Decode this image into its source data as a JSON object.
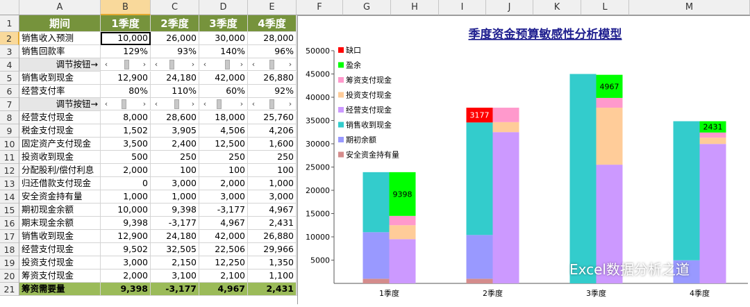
{
  "columns": [
    "A",
    "B",
    "C",
    "D",
    "E",
    "F",
    "G",
    "H",
    "I",
    "J",
    "K",
    "L",
    "M"
  ],
  "selected_column": "B",
  "selected_row": 2,
  "header_row": [
    "期间",
    "1季度",
    "2季度",
    "3季度",
    "4季度"
  ],
  "rows": [
    {
      "n": 2,
      "label": "销售收入预测",
      "vals": [
        "10,000",
        "26,000",
        "30,000",
        "28,000"
      ]
    },
    {
      "n": 3,
      "label": "销售回款率",
      "vals": [
        "129%",
        "93%",
        "140%",
        "96%"
      ]
    },
    {
      "n": 4,
      "label": "调节按钮→",
      "scroll": true,
      "thumbs": [
        0.55,
        0.35,
        0.7,
        0.5
      ]
    },
    {
      "n": 5,
      "label": "销售收到现金",
      "vals": [
        "12,900",
        "24,180",
        "42,000",
        "26,880"
      ]
    },
    {
      "n": 6,
      "label": "经营支付率",
      "vals": [
        "80%",
        "110%",
        "60%",
        "92%"
      ]
    },
    {
      "n": 7,
      "label": "调节按钮→",
      "scroll": true,
      "thumbs": [
        0.45,
        0.6,
        0.3,
        0.5
      ]
    },
    {
      "n": 8,
      "label": "经营支付现金",
      "vals": [
        "8,000",
        "28,600",
        "18,000",
        "25,760"
      ]
    },
    {
      "n": 9,
      "label": "税金支付现金",
      "vals": [
        "1,502",
        "3,905",
        "4,506",
        "4,206"
      ]
    },
    {
      "n": 10,
      "label": "固定资产支付现金",
      "vals": [
        "3,500",
        "2,400",
        "12,500",
        "1,600"
      ]
    },
    {
      "n": 11,
      "label": "投资收到现金",
      "vals": [
        "500",
        "250",
        "250",
        "250"
      ]
    },
    {
      "n": 12,
      "label": "分配股利/偿付利息",
      "vals": [
        "2,000",
        "100",
        "100",
        "100"
      ]
    },
    {
      "n": 13,
      "label": "归还借款支付现金",
      "vals": [
        "0",
        "3,000",
        "2,000",
        "1,000"
      ]
    },
    {
      "n": 14,
      "label": "安全资金持有量",
      "vals": [
        "1,000",
        "1,000",
        "3,000",
        "3,000"
      ]
    },
    {
      "n": 15,
      "label": "期初现金余额",
      "vals": [
        "10,000",
        "9,398",
        "-3,177",
        "4,967"
      ]
    },
    {
      "n": 16,
      "label": "期末现金余额",
      "vals": [
        "9,398",
        "-3,177",
        "4,967",
        "2,431"
      ]
    },
    {
      "n": 17,
      "label": "销售收到现金",
      "vals": [
        "12,900",
        "24,180",
        "42,000",
        "26,880"
      ]
    },
    {
      "n": 18,
      "label": "经营支付现金",
      "vals": [
        "9,502",
        "32,505",
        "22,506",
        "29,966"
      ]
    },
    {
      "n": 19,
      "label": "投资支付现金",
      "vals": [
        "3,000",
        "2,150",
        "12,250",
        "1,350"
      ]
    },
    {
      "n": 20,
      "label": "筹资支付现金",
      "vals": [
        "2,000",
        "3,100",
        "2,100",
        "1,100"
      ]
    },
    {
      "n": 21,
      "label": "筹资需要量",
      "vals": [
        "9,398",
        "-3,177",
        "4,967",
        "2,431"
      ],
      "total": true
    }
  ],
  "chart_data": {
    "type": "bar",
    "title": "季度资金预算敏感性分析模型",
    "categories": [
      "1季度",
      "2季度",
      "3季度",
      "4季度"
    ],
    "ylim": [
      0,
      50000
    ],
    "yticks": [
      "5000",
      "10000",
      "15000",
      "20000",
      "25000",
      "30000",
      "35000",
      "40000",
      "45000",
      "50000"
    ],
    "legend_position": "top-left",
    "stacks": [
      {
        "name": "left",
        "series": [
          {
            "name": "安全资金持有量",
            "color": "#d48c8c",
            "values": [
              1000,
              1000,
              0,
              0
            ]
          },
          {
            "name": "期初余额",
            "color": "#9999ff",
            "values": [
              10000,
              9398,
              0,
              4967
            ]
          },
          {
            "name": "销售收到现金",
            "color": "#33cccc",
            "values": [
              12900,
              24180,
              45000,
              29880
            ]
          },
          {
            "name": "缺口",
            "color": "#ff0000",
            "values": [
              0,
              3177,
              0,
              0
            ]
          }
        ]
      },
      {
        "name": "right",
        "series": [
          {
            "name": "经营支付现金",
            "color": "#cc99ff",
            "values": [
              9502,
              32505,
              25506,
              29966
            ]
          },
          {
            "name": "投资支付现金",
            "color": "#ffcc99",
            "values": [
              3000,
              2150,
              12250,
              1350
            ]
          },
          {
            "name": "筹资支付现金",
            "color": "#ff99cc",
            "values": [
              2000,
              3100,
              2100,
              1100
            ]
          },
          {
            "name": "盈余",
            "color": "#00ff00",
            "values": [
              9398,
              0,
              4967,
              2431
            ]
          }
        ]
      }
    ],
    "data_labels": [
      {
        "category": "1季度",
        "stack": "right",
        "series": "盈余",
        "text": "9398"
      },
      {
        "category": "2季度",
        "stack": "left",
        "series": "缺口",
        "text": "3177"
      },
      {
        "category": "3季度",
        "stack": "right",
        "series": "盈余",
        "text": "4967"
      },
      {
        "category": "4季度",
        "stack": "right",
        "series": "盈余",
        "text": "2431"
      }
    ],
    "legend": [
      {
        "name": "缺口",
        "color": "#ff0000"
      },
      {
        "name": "盈余",
        "color": "#00ff00"
      },
      {
        "name": "筹资支付现金",
        "color": "#ff99cc"
      },
      {
        "name": "投资支付现金",
        "color": "#ffcc99"
      },
      {
        "name": "经营支付现金",
        "color": "#cc99ff"
      },
      {
        "name": "销售收到现金",
        "color": "#33cccc"
      },
      {
        "name": "期初余额",
        "color": "#9999ff"
      },
      {
        "name": "安全资金持有量",
        "color": "#d48c8c"
      }
    ]
  },
  "watermark": "Excel数据分析之道",
  "colors": {
    "header_green": "#76933c",
    "total_green": "#9bbb59",
    "selection": "#f9d99b"
  }
}
